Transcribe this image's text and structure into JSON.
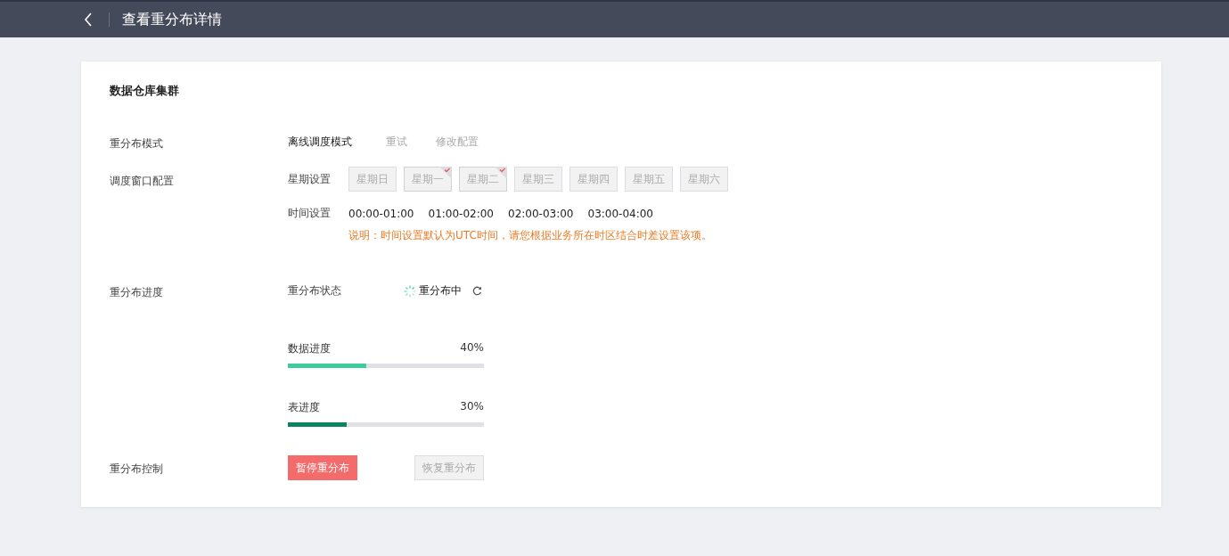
{
  "header": {
    "title": "查看重分布详情"
  },
  "card": {
    "title": "数据仓库集群",
    "mode": {
      "label": "重分布模式",
      "value": "离线调度模式",
      "actions": [
        "重试",
        "修改配置"
      ]
    },
    "window": {
      "label": "调度窗口配置",
      "week_label": "星期设置",
      "weekdays": [
        {
          "label": "星期日",
          "selected": false
        },
        {
          "label": "星期一",
          "selected": true
        },
        {
          "label": "星期二",
          "selected": true
        },
        {
          "label": "星期三",
          "selected": false
        },
        {
          "label": "星期四",
          "selected": false
        },
        {
          "label": "星期五",
          "selected": false
        },
        {
          "label": "星期六",
          "selected": false
        }
      ],
      "time_label": "时间设置",
      "times": [
        "00:00-01:00",
        "01:00-02:00",
        "02:00-03:00",
        "03:00-04:00"
      ],
      "note": "说明：时间设置默认为UTC时间，请您根据业务所在时区结合时差设置该项。"
    },
    "progress": {
      "label": "重分布进度",
      "status_label": "重分布状态",
      "status": "重分布中",
      "bars": [
        {
          "label": "数据进度",
          "reading": "40%",
          "level": 0.4,
          "color": "#3ccc9e"
        },
        {
          "label": "表进度",
          "reading": "30%",
          "level": 0.3,
          "color": "#09855f"
        }
      ]
    },
    "control": {
      "label": "重分布控制",
      "buttons": [
        {
          "label": "暂停重分布",
          "kind": "primary",
          "disabled": false
        },
        {
          "label": "恢复重分布",
          "kind": "default",
          "disabled": true
        }
      ]
    }
  }
}
